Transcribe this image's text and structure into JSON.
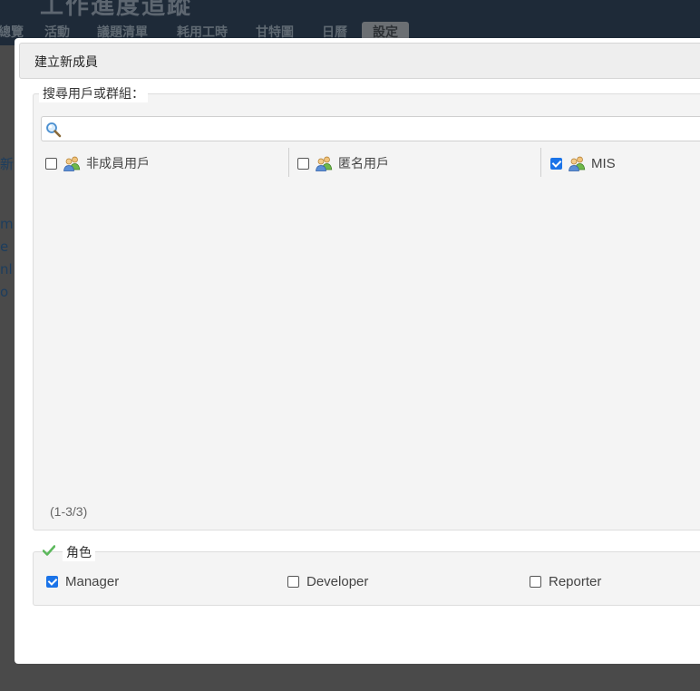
{
  "background": {
    "title": "工作進度追蹤",
    "tabs": [
      "總覽",
      "活動",
      "議題清單",
      "耗用工時",
      "甘特圖",
      "日曆",
      "設定"
    ],
    "active_tab": "設定",
    "left_fragments": [
      "新",
      "m",
      "e",
      "nl",
      "o"
    ]
  },
  "modal": {
    "title": "建立新成員",
    "principals": {
      "legend": "搜尋用戶或群組：",
      "search_value": "",
      "search_icon": "magnifier-icon",
      "items": [
        {
          "label": "非成員用戶",
          "checked": false,
          "icon": "group-icon"
        },
        {
          "label": "匿名用戶",
          "checked": false,
          "icon": "group-icon"
        },
        {
          "label": "MIS",
          "checked": true,
          "icon": "group-icon"
        }
      ],
      "pagination": "(1-3/3)"
    },
    "roles": {
      "legend": "角色",
      "legend_icon": "checkmark-icon",
      "items": [
        {
          "label": "Manager",
          "checked": true
        },
        {
          "label": "Developer",
          "checked": false
        },
        {
          "label": "Reporter",
          "checked": false
        }
      ]
    }
  },
  "colors": {
    "header_bg": "#1e2a38",
    "overlay_bg": "#4a4a4a",
    "checkbox_checked": "#1a73e8",
    "check_icon": "#5cb85c"
  }
}
